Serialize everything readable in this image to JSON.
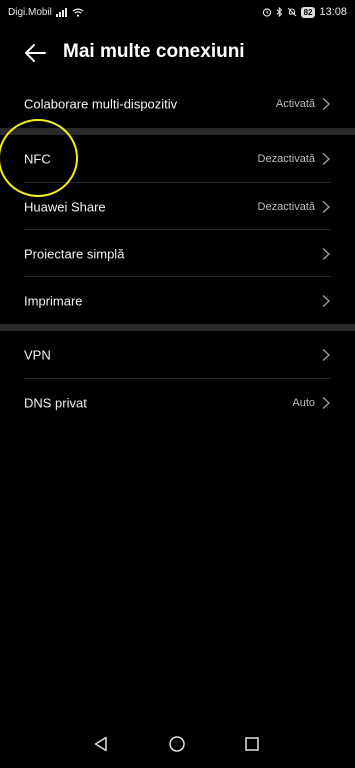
{
  "statusbar": {
    "carrier": "Digi.Mobil",
    "battery": "82",
    "time": "13:08"
  },
  "header": {
    "title": "Mai multe conexiuni"
  },
  "section1": {
    "items": [
      {
        "label": "Colaborare multi-dispozitiv",
        "value": "Activată"
      }
    ]
  },
  "section2": {
    "items": [
      {
        "label": "NFC",
        "value": "Dezactivată"
      },
      {
        "label": "Huawei Share",
        "value": "Dezactivată"
      },
      {
        "label": "Proiectare simplă",
        "value": ""
      },
      {
        "label": "Imprimare",
        "value": ""
      }
    ]
  },
  "section3": {
    "items": [
      {
        "label": "VPN",
        "value": ""
      },
      {
        "label": "DNS privat",
        "value": "Auto"
      }
    ]
  },
  "icons": {
    "back": "back-arrow-icon",
    "chevron": "chevron-right-icon",
    "nav_back": "triangle-back-icon",
    "nav_home": "circle-home-icon",
    "nav_recents": "square-recents-icon"
  },
  "colors": {
    "background": "#000000",
    "annotation": "#f4ee18",
    "value_text": "#bdbdbd"
  }
}
